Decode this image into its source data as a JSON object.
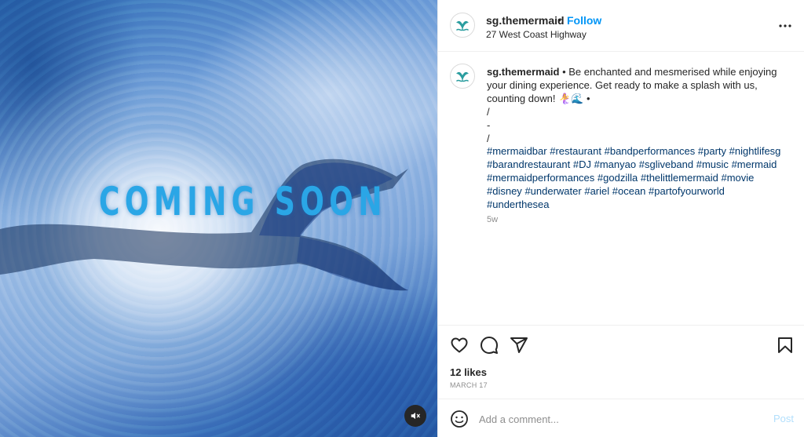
{
  "media": {
    "overlay_text": "COMING SOON",
    "mute_icon": "speaker-muted-icon"
  },
  "header": {
    "username": "sg.themermaid",
    "separator": "•",
    "follow_label": "Follow",
    "location": "27 West Coast Highway",
    "avatar_icon": "mermaid-tail-logo-icon",
    "more_icon": "more-options-icon"
  },
  "caption": {
    "username": "sg.themermaid",
    "text": " • Be enchanted and mesmerised while enjoying your dining experience. Get ready to make a splash with us, counting down! 🧜‍♀️🌊 •\n/\n-\n/",
    "hashtags": [
      "#mermaidbar",
      "#restaurant",
      "#bandperformances",
      "#party",
      "#nightlifesg",
      "#barandrestaurant",
      "#DJ",
      "#manyao",
      "#sgliveband",
      "#music",
      "#mermaid",
      "#mermaidperformances",
      "#godzilla",
      "#thelittlemermaid",
      "#movie",
      "#disney",
      "#underwater",
      "#ariel",
      "#ocean",
      "#partofyourworld",
      "#underthesea"
    ],
    "time_ago": "5w"
  },
  "actions": {
    "like_icon": "heart-icon",
    "comment_icon": "comment-icon",
    "share_icon": "share-icon",
    "save_icon": "bookmark-icon"
  },
  "likes": "12 likes",
  "post_date": "MARCH 17",
  "comment": {
    "placeholder": "Add a comment...",
    "post_label": "Post",
    "emoji_icon": "emoji-icon"
  },
  "colors": {
    "accent": "#0095f6",
    "post_disabled": "#b2dffc",
    "hashtag": "#00376b",
    "overlay_text": "#2aa6e6",
    "logo": "#2a9d9f"
  }
}
